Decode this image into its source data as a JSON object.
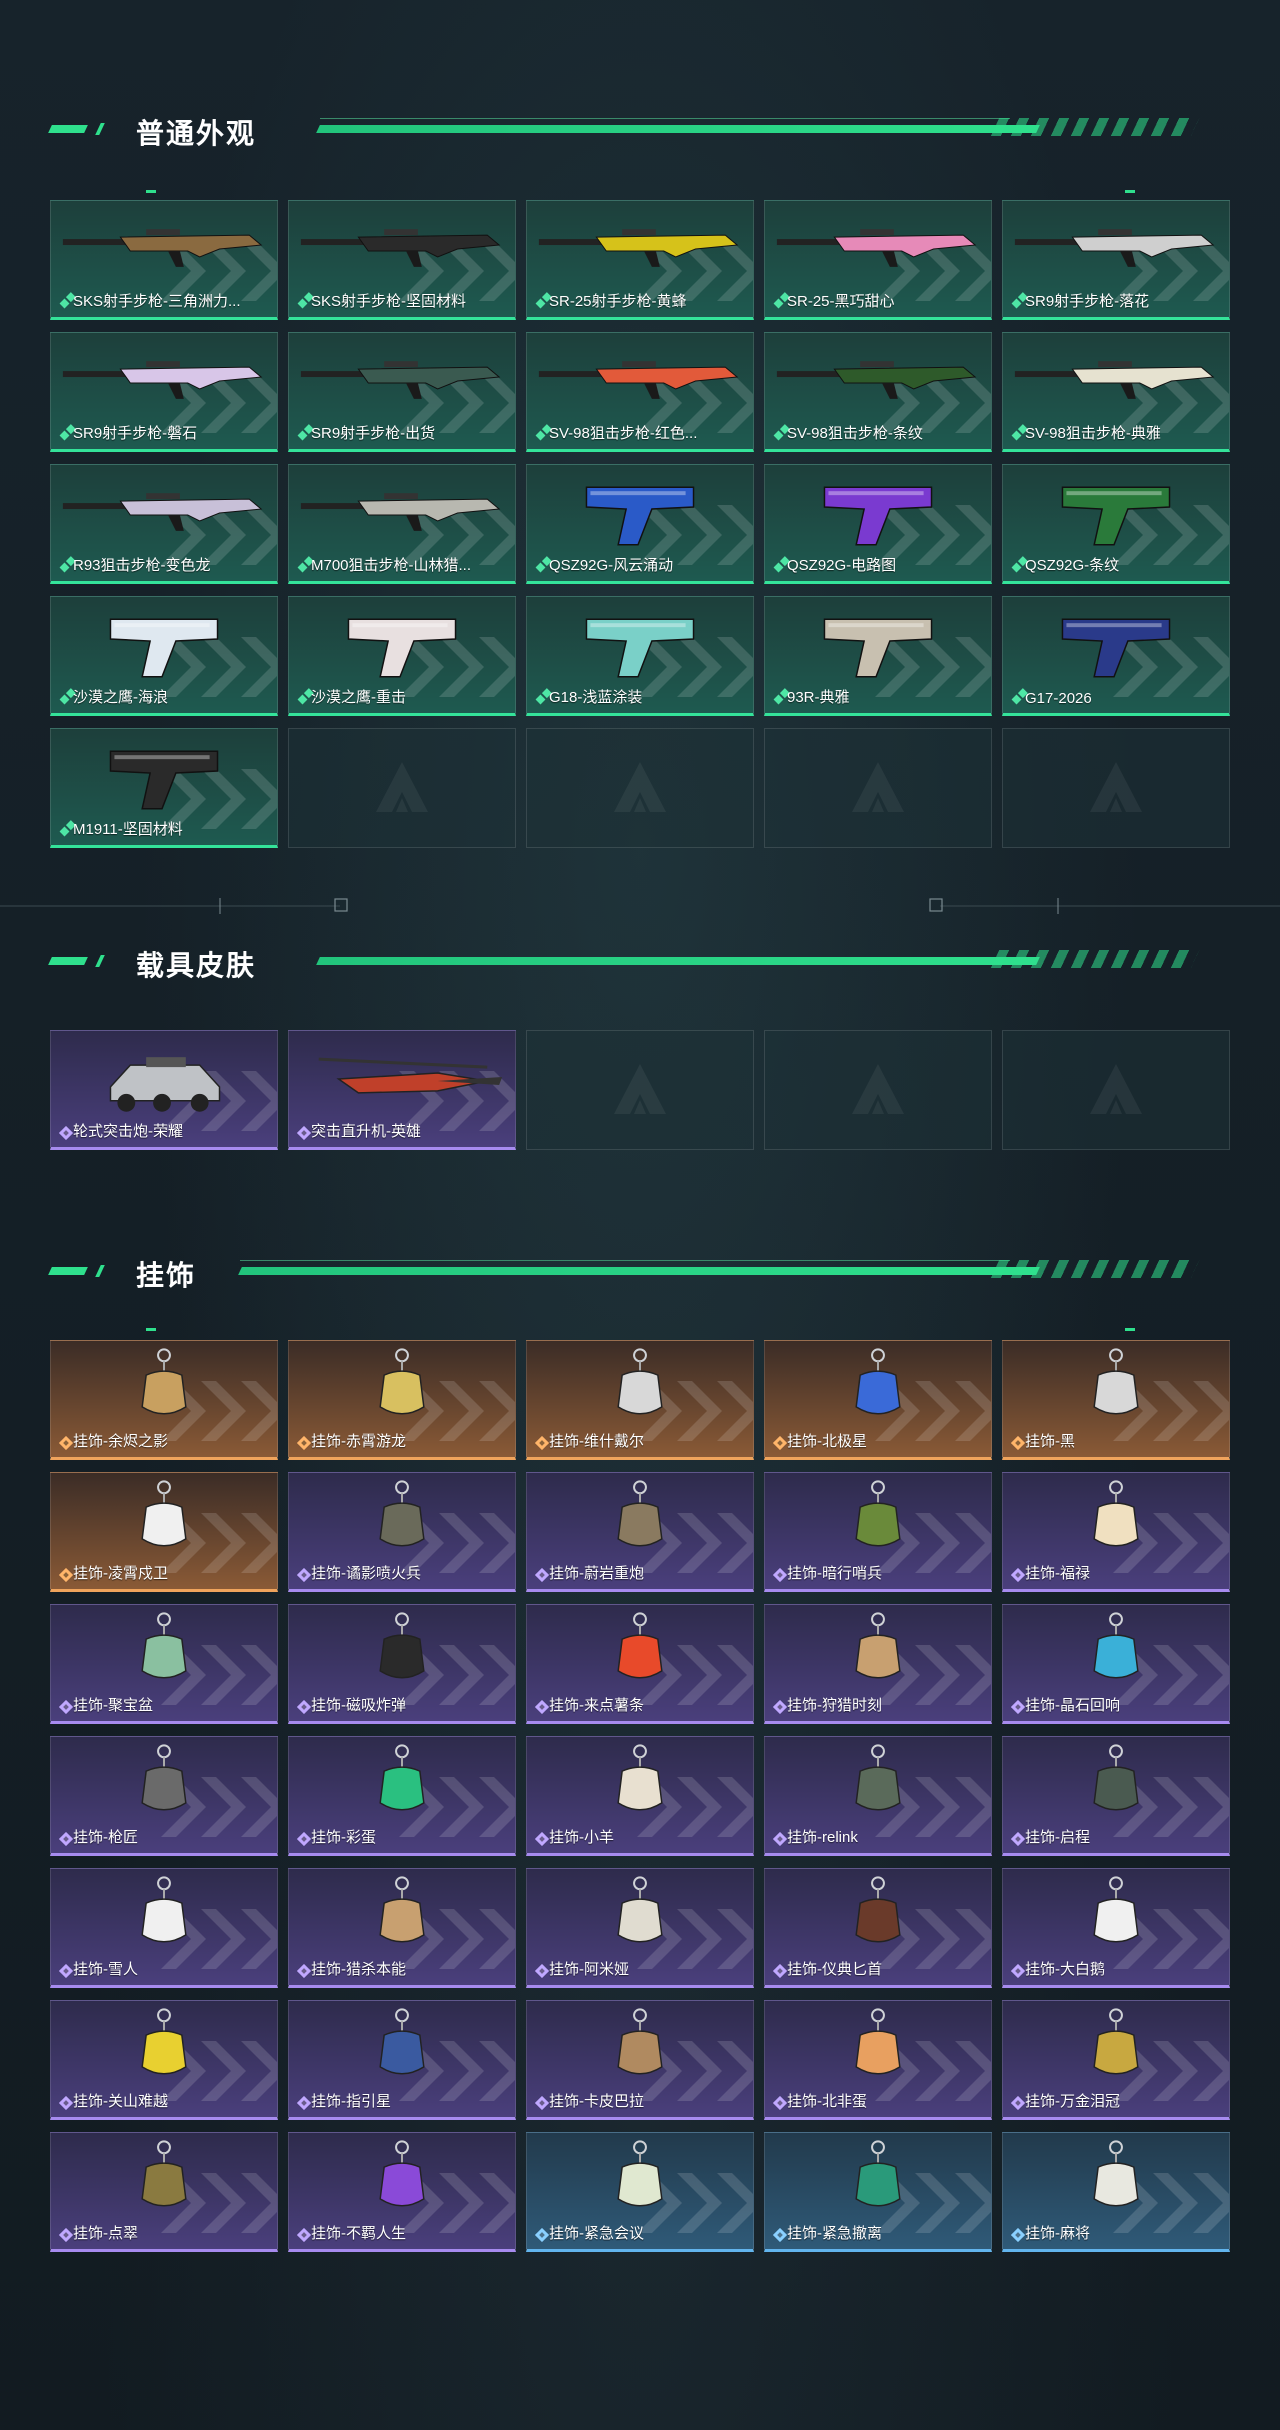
{
  "sections": {
    "weapons": {
      "title": "普通外观",
      "items": [
        {
          "name": "SKS射手步枪-三角洲力...",
          "icon": "rifle-icon",
          "color": "#8a6a40"
        },
        {
          "name": "SKS射手步枪-坚固材料",
          "icon": "rifle-icon",
          "color": "#2a2a2a"
        },
        {
          "name": "SR-25射手步枪-黄蜂",
          "icon": "rifle-icon",
          "color": "#d6c21a"
        },
        {
          "name": "SR-25-黑巧甜心",
          "icon": "rifle-icon",
          "color": "#e68ab8"
        },
        {
          "name": "SR9射手步枪-落花",
          "icon": "rifle-icon",
          "color": "#cfcfcf"
        },
        {
          "name": "SR9射手步枪-磐石",
          "icon": "rifle-icon",
          "color": "#d8c6e8"
        },
        {
          "name": "SR9射手步枪-出货",
          "icon": "rifle-icon",
          "color": "#3a5a50"
        },
        {
          "name": "SV-98狙击步枪-红色...",
          "icon": "rifle-icon",
          "color": "#e25a3a"
        },
        {
          "name": "SV-98狙击步枪-条纹",
          "icon": "rifle-icon",
          "color": "#2e5a2a"
        },
        {
          "name": "SV-98狙击步枪-典雅",
          "icon": "rifle-icon",
          "color": "#e6e2d0"
        },
        {
          "name": "R93狙击步枪-变色龙",
          "icon": "rifle-icon",
          "color": "#c8c0d8"
        },
        {
          "name": "M700狙击步枪-山林猎...",
          "icon": "rifle-icon",
          "color": "#b8b8b0"
        },
        {
          "name": "QSZ92G-风云涌动",
          "icon": "pistol-icon",
          "color": "#2a5ac8"
        },
        {
          "name": "QSZ92G-电路图",
          "icon": "pistol-icon",
          "color": "#7a3ad0"
        },
        {
          "name": "QSZ92G-条纹",
          "icon": "pistol-icon",
          "color": "#2a7a3a"
        },
        {
          "name": "沙漠之鹰-海浪",
          "icon": "pistol-icon",
          "color": "#dfe8f0"
        },
        {
          "name": "沙漠之鹰-重击",
          "icon": "pistol-icon",
          "color": "#e8e0e0"
        },
        {
          "name": "G18-浅蓝涂装",
          "icon": "pistol-icon",
          "color": "#7ad0c8"
        },
        {
          "name": "93R-典雅",
          "icon": "pistol-icon",
          "color": "#c8c0b0"
        },
        {
          "name": "G17-2026",
          "icon": "pistol-icon",
          "color": "#2a3a8a"
        },
        {
          "name": "M1911-坚固材料",
          "icon": "pistol-icon",
          "color": "#2a2a2a"
        }
      ],
      "empty_count": 4
    },
    "vehicles": {
      "title": "载具皮肤",
      "items": [
        {
          "name": "轮式突击炮-荣耀",
          "icon": "vehicle-icon",
          "color": "#bfc2c6"
        },
        {
          "name": "突击直升机-英雄",
          "icon": "helicopter-icon",
          "color": "#c0402a"
        }
      ],
      "empty_count": 3
    },
    "charms": {
      "title": "挂饰",
      "items": [
        {
          "name": "挂饰-余烬之影",
          "rarity": "orange",
          "color": "#c8a060"
        },
        {
          "name": "挂饰-赤霄游龙",
          "rarity": "orange",
          "color": "#d8c060"
        },
        {
          "name": "挂饰-维什戴尔",
          "rarity": "orange",
          "color": "#d8d8d8"
        },
        {
          "name": "挂饰-北极星",
          "rarity": "orange",
          "color": "#3a6ad8"
        },
        {
          "name": "挂饰-黑",
          "rarity": "orange",
          "color": "#d8d8d8"
        },
        {
          "name": "挂饰-凌霄戍卫",
          "rarity": "orange",
          "color": "#f0f0f0"
        },
        {
          "name": "挂饰-谲影喷火兵",
          "rarity": "purple",
          "color": "#6a6a5a"
        },
        {
          "name": "挂饰-蔚岩重炮",
          "rarity": "purple",
          "color": "#8a7a60"
        },
        {
          "name": "挂饰-暗行哨兵",
          "rarity": "purple",
          "color": "#6a8a3a"
        },
        {
          "name": "挂饰-福禄",
          "rarity": "purple",
          "color": "#f0e0c0"
        },
        {
          "name": "挂饰-聚宝盆",
          "rarity": "purple",
          "color": "#8ac0a0"
        },
        {
          "name": "挂饰-磁吸炸弹",
          "rarity": "purple",
          "color": "#2a2a2a"
        },
        {
          "name": "挂饰-来点薯条",
          "rarity": "purple",
          "color": "#e84a2a"
        },
        {
          "name": "挂饰-狩猎时刻",
          "rarity": "purple",
          "color": "#c8a070"
        },
        {
          "name": "挂饰-晶石回响",
          "rarity": "purple",
          "color": "#3ab0d8"
        },
        {
          "name": "挂饰-枪匠",
          "rarity": "purple",
          "color": "#6a6a6a"
        },
        {
          "name": "挂饰-彩蛋",
          "rarity": "purple",
          "color": "#2ac080"
        },
        {
          "name": "挂饰-小羊",
          "rarity": "purple",
          "color": "#e8e0d0"
        },
        {
          "name": "挂饰-relink",
          "rarity": "purple",
          "color": "#5a6a5a"
        },
        {
          "name": "挂饰-启程",
          "rarity": "purple",
          "color": "#4a5a50"
        },
        {
          "name": "挂饰-雪人",
          "rarity": "purple",
          "color": "#f0f0f0"
        },
        {
          "name": "挂饰-猎杀本能",
          "rarity": "purple",
          "color": "#c8a070"
        },
        {
          "name": "挂饰-阿米娅",
          "rarity": "purple",
          "color": "#e0dcd0"
        },
        {
          "name": "挂饰-仪典匕首",
          "rarity": "purple",
          "color": "#6a3a2a"
        },
        {
          "name": "挂饰-大白鹅",
          "rarity": "purple",
          "color": "#f0f0f0"
        },
        {
          "name": "挂饰-关山难越",
          "rarity": "purple",
          "color": "#e8d030"
        },
        {
          "name": "挂饰-指引星",
          "rarity": "purple",
          "color": "#3a5aa0"
        },
        {
          "name": "挂饰-卡皮巴拉",
          "rarity": "purple",
          "color": "#b08a60"
        },
        {
          "name": "挂饰-北非蛋",
          "rarity": "purple",
          "color": "#e8a060"
        },
        {
          "name": "挂饰-万金泪冠",
          "rarity": "purple",
          "color": "#c8a840"
        },
        {
          "name": "挂饰-点翠",
          "rarity": "purple",
          "color": "#8a7a40"
        },
        {
          "name": "挂饰-不羁人生",
          "rarity": "purple",
          "color": "#8a4ad8"
        },
        {
          "name": "挂饰-紧急会议",
          "rarity": "blue",
          "color": "#e0e8d0"
        },
        {
          "name": "挂饰-紧急撤离",
          "rarity": "blue",
          "color": "#2a9a7a"
        },
        {
          "name": "挂饰-麻将",
          "rarity": "blue",
          "color": "#e8e8e0"
        }
      ],
      "empty_count": 0
    }
  },
  "colors": {
    "accent": "#2fe08d",
    "green_rarity": "#34e39a",
    "purple_rarity": "#a78bef",
    "orange_rarity": "#f0a45c",
    "blue_rarity": "#62b5ee"
  }
}
